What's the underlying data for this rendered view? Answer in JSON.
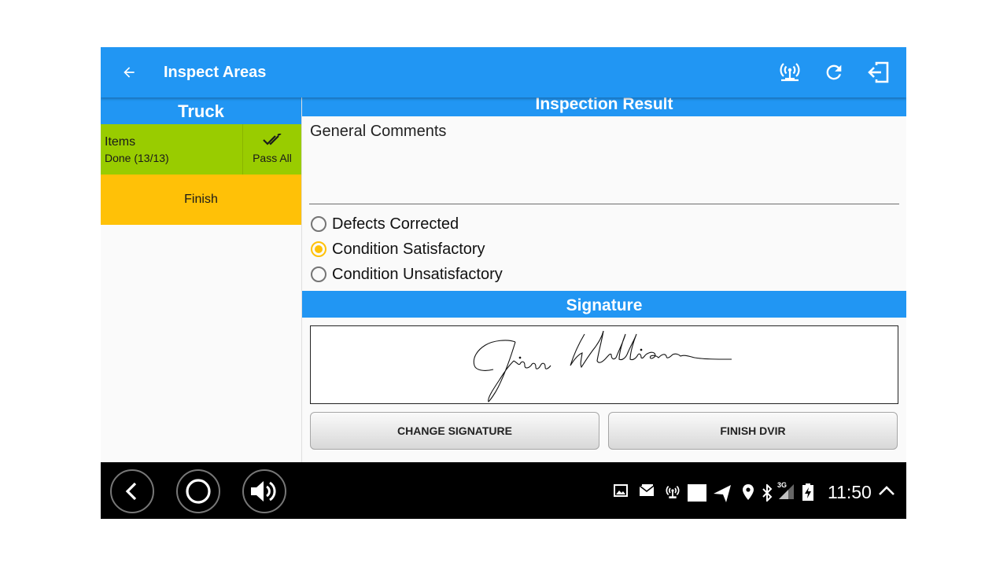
{
  "app_bar": {
    "title": "Inspect Areas",
    "icons": [
      "back-arrow-icon",
      "wifi-tethering-icon",
      "refresh-icon",
      "logout-icon"
    ]
  },
  "left_panel": {
    "header": "Truck",
    "items_label": "Items",
    "items_status": "Done (13/13)",
    "pass_all_label": "Pass All",
    "finish_label": "Finish"
  },
  "inspection": {
    "header": "Inspection Result",
    "comments_placeholder": "General Comments",
    "options": [
      {
        "label": "Defects Corrected",
        "checked": false
      },
      {
        "label": "Condition Satisfactory",
        "checked": true
      },
      {
        "label": "Condition Unsatisfactory",
        "checked": false
      }
    ]
  },
  "signature": {
    "header": "Signature",
    "change_button": "CHANGE SIGNATURE",
    "finish_button": "FINISH DVIR"
  },
  "system_bar": {
    "clock": "11:50",
    "network_label": "3G"
  },
  "colors": {
    "primary": "#2196F3",
    "items_green": "#99CC00",
    "finish_amber": "#FFC107",
    "radio_accent": "#FFC107"
  }
}
